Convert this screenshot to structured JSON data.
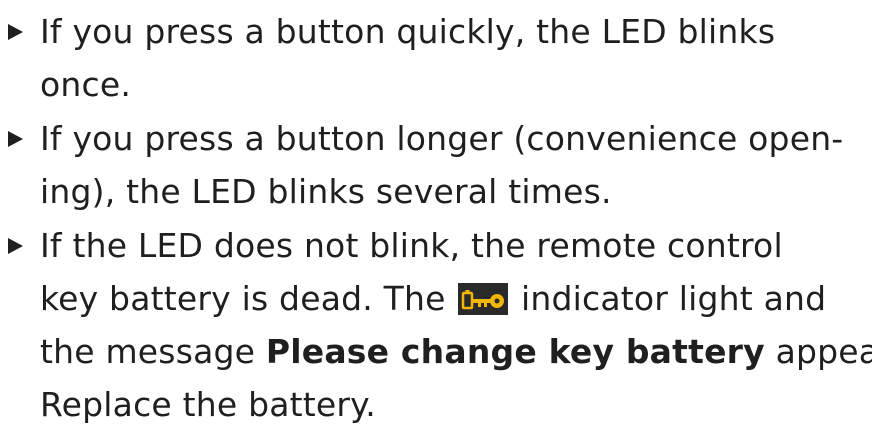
{
  "bullets": [
    {
      "lines": [
        "If you press a button quickly, the LED blinks",
        "once."
      ]
    },
    {
      "lines": [
        "If you press a button longer (convenience open-",
        "ing), the LED blinks several times."
      ]
    },
    {
      "line1": "If the LED does not blink, the remote control",
      "line2_before": "key battery is dead. The ",
      "line2_after": " indicator light and",
      "line3_before": "the message ",
      "line3_bold": "Please change key battery",
      "line3_after": " appear.",
      "line4": "Replace the battery."
    }
  ],
  "icons": {
    "marker": "triangle-right-icon",
    "indicator": "key-battery-warning-icon",
    "indicator_color": "#f2b705"
  }
}
